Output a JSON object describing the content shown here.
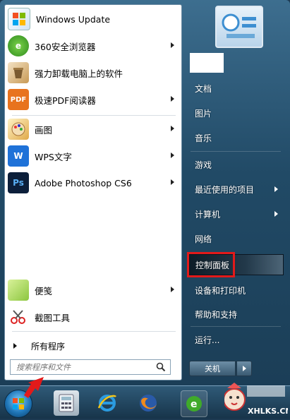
{
  "programs": [
    {
      "label": "Windows Update",
      "icon": "windows-update-icon",
      "has_arrow": false
    },
    {
      "label": "360安全浏览器",
      "icon": "360-browser-icon",
      "has_arrow": true
    },
    {
      "label": "强力卸载电脑上的软件",
      "icon": "uninstall-icon",
      "has_arrow": false
    },
    {
      "label": "极速PDF阅读器",
      "icon": "pdf-reader-icon",
      "has_arrow": true
    },
    {
      "label": "画图",
      "icon": "paint-icon",
      "has_arrow": true
    },
    {
      "label": "WPS文字",
      "icon": "wps-writer-icon",
      "has_arrow": true
    },
    {
      "label": "Adobe Photoshop CS6",
      "icon": "photoshop-icon",
      "has_arrow": true
    },
    {
      "label": "便笺",
      "icon": "sticky-notes-icon",
      "has_arrow": true
    },
    {
      "label": "截图工具",
      "icon": "snipping-tool-icon",
      "has_arrow": false
    }
  ],
  "all_programs_label": "所有程序",
  "search": {
    "placeholder": "搜索程序和文件"
  },
  "right_items": [
    {
      "label": "文档",
      "has_arrow": false
    },
    {
      "label": "图片",
      "has_arrow": false
    },
    {
      "label": "音乐",
      "has_arrow": false
    },
    {
      "label": "游戏",
      "has_arrow": false
    },
    {
      "label": "最近使用的项目",
      "has_arrow": true
    },
    {
      "label": "计算机",
      "has_arrow": true
    },
    {
      "label": "网络",
      "has_arrow": false
    },
    {
      "label": "控制面板",
      "has_arrow": false,
      "highlighted": true
    },
    {
      "label": "设备和打印机",
      "has_arrow": false
    },
    {
      "label": "帮助和支持",
      "has_arrow": false
    },
    {
      "label": "运行...",
      "has_arrow": false
    }
  ],
  "shutdown_label": "关机",
  "taskbar": [
    "calculator-icon",
    "ie-icon",
    "firefox-icon",
    "360-browser-icon"
  ],
  "watermark": {
    "text": "XHLKS.CN"
  }
}
